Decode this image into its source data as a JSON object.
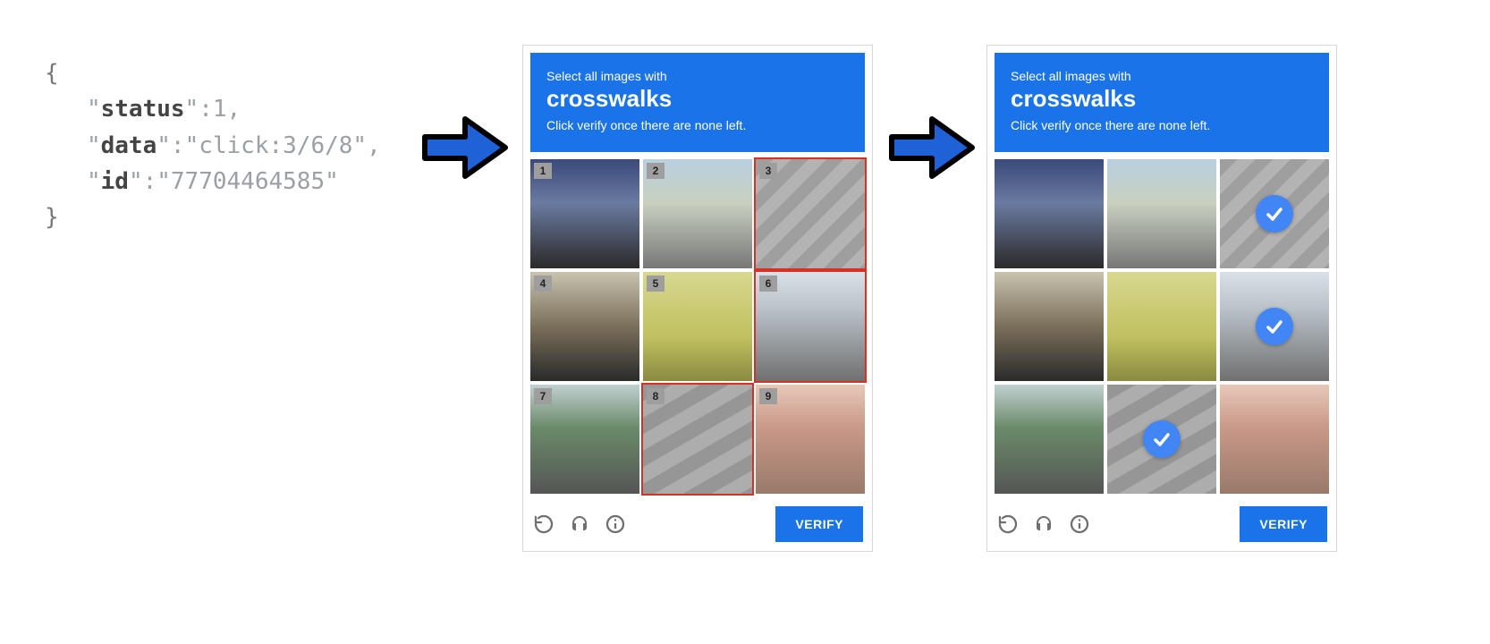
{
  "json_payload": {
    "status_key": "status",
    "status_value": 1,
    "data_key": "data",
    "data_value": "click:3/6/8",
    "id_key": "id",
    "id_value": "77704464585"
  },
  "captcha_left": {
    "prompt_line1": "Select all images with",
    "prompt_target": "crosswalks",
    "prompt_line3": "Click verify once there are none left.",
    "tiles": [
      {
        "num": "1",
        "selected": false
      },
      {
        "num": "2",
        "selected": false
      },
      {
        "num": "3",
        "selected": true
      },
      {
        "num": "4",
        "selected": false
      },
      {
        "num": "5",
        "selected": false
      },
      {
        "num": "6",
        "selected": true
      },
      {
        "num": "7",
        "selected": false
      },
      {
        "num": "8",
        "selected": true
      },
      {
        "num": "9",
        "selected": false
      }
    ],
    "verify_label": "VERIFY"
  },
  "captcha_right": {
    "prompt_line1": "Select all images with",
    "prompt_target": "crosswalks",
    "prompt_line3": "Click verify once there are none left.",
    "checked_tiles": [
      3,
      6,
      8
    ],
    "verify_label": "VERIFY"
  },
  "colors": {
    "accent": "#1a73e8",
    "select_outline": "#d93025",
    "arrow_fill": "#1f62d8"
  }
}
